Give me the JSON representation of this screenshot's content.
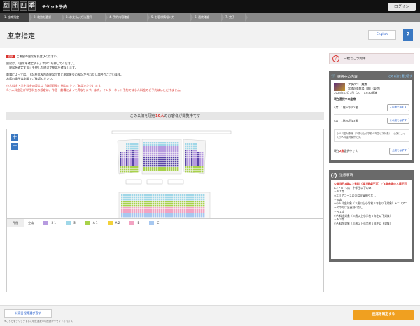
{
  "header": {
    "logo_chars": [
      "劇",
      "団",
      "四",
      "季"
    ],
    "title": "チケット予約",
    "login": "ログイン"
  },
  "steps": [
    "1. 座席指定",
    "2. 枚数を選択",
    "3. お支払い方法選択",
    "4. 予約内容確認",
    "5. お客様情報入力",
    "6. 最終確認",
    "7. 完了"
  ],
  "page": {
    "title": "座席指定",
    "english": "English",
    "help": "?"
  },
  "notice": {
    "tag": "必須",
    "line1": "ご希望の座席をお選びください。",
    "lines": [
      "座席は、「座席を確定する」ボタンを押してください。",
      "「座席を確定する」を押した時点で座席を確保します。"
    ],
    "lines2": [
      "劇場によっては、下記座席表内の座席位置と座席番号の表記が合わない場合がございます。",
      "お席の場所は劇場でご確認ください。"
    ],
    "red1": "小人料金・学生料金の設定は「劇団四季」指定の上でご確認いただけます。",
    "red2": "※小人料金及び学生料金の設定は、作品・劇場によって異なります。また、インターネット予約では小人料金のご予約はいただけません。"
  },
  "count_bar": {
    "pre": "この公演を現在",
    "num": "10人",
    "post": "のお客様が閲覧中です"
  },
  "zoom": {
    "in": "+",
    "out": "−"
  },
  "legend": {
    "title": "凡例",
    "items": [
      {
        "label": "空席",
        "color": "#333333"
      },
      {
        "label": "S 1",
        "color": "#b79be0"
      },
      {
        "label": "S",
        "color": "#9fd7e8"
      },
      {
        "label": "A 1",
        "color": "#a8d24a"
      },
      {
        "label": "A 2",
        "color": "#f2d13a"
      },
      {
        "label": "B",
        "color": "#f2a3c2"
      },
      {
        "label": "C",
        "color": "#a7c8f0"
      }
    ]
  },
  "sidebar": {
    "status": "一枚でご予約中",
    "sel_title": "選択中の内容",
    "change": "この公演を選び直す",
    "show_name": "アラジン　東京",
    "venue": "電通四季劇場［海］（東京）",
    "datetime": "2023年12月7日（木）　13:30開演",
    "seat_head": "現在選択中の座席",
    "seats": [
      "S席　1階20列12番",
      "S席　1階20列13番"
    ],
    "cancel": "この席をはずす",
    "small_note": "小人料金対象席（３歳以上小学校６年生以下対象）…公演によって小人料金対象外です。",
    "count_line_pre": "現在",
    "count_num": "2席",
    "count_line_post": "選択中です。",
    "cancel_all": "全席をはずす",
    "caution_title": "注意事項",
    "caution_red": "公演当日3歳以上有料（膝上観劇不可）／3歳未満の入場不可",
    "caution_lines": [
      "A２・B・C席　中学生以下のみ",
      "－ＳＩ席",
      "※エリアコースの方は全員割引なし",
      "－Ｓ席",
      "※小人料金対象（３歳以上小学校６年生以下対象）※エリアコースの方は全員割引なし",
      "－Ａ１席",
      "小人料金対象（３歳以上小学校６年生以下対象）",
      "－Ａ２席",
      "小人料金対象（３歳以上小学校６年生以下対象）"
    ]
  },
  "bottom": {
    "back": "公演日程等選び直す",
    "back_note": "※こちらをクリックすると現在選択中の座席がリセットされます。",
    "confirm": "座席を確定する"
  }
}
